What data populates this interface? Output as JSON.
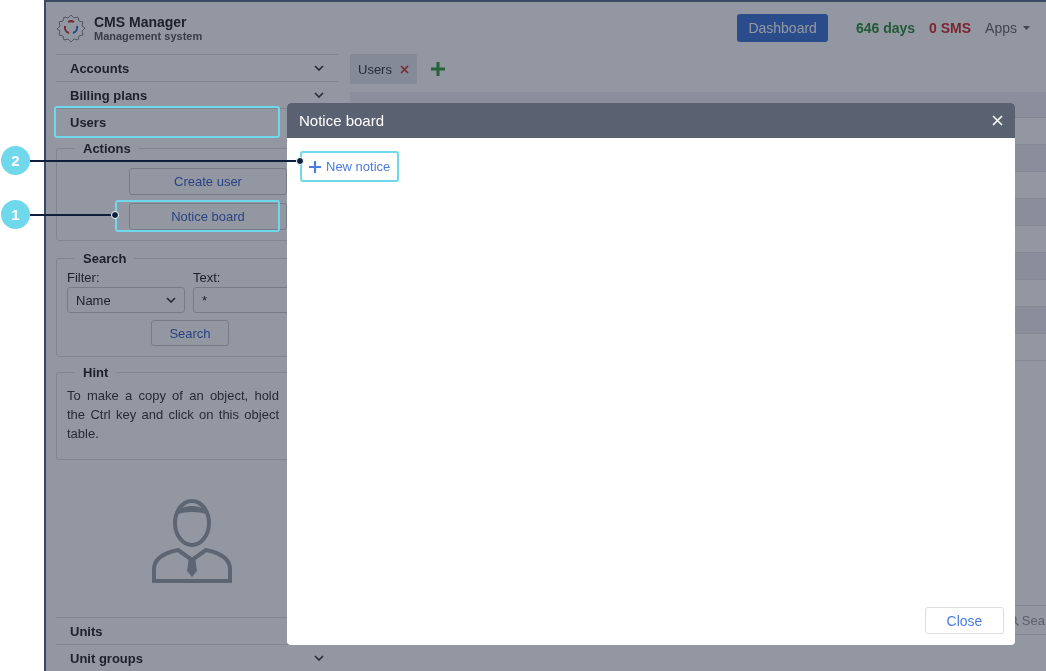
{
  "callouts": [
    {
      "number": "2"
    },
    {
      "number": "1"
    }
  ],
  "app": {
    "title": "CMS Manager",
    "subtitle": "Management system"
  },
  "header": {
    "dashboard": "Dashboard",
    "days": "646 days",
    "sms": "0 SMS",
    "apps": "Apps"
  },
  "sidebar": {
    "items": [
      {
        "label": "Accounts",
        "chevron": true
      },
      {
        "label": "Billing plans",
        "chevron": true
      },
      {
        "label": "Users"
      }
    ],
    "actions": {
      "legend": "Actions",
      "buttons": [
        "Create user",
        "Notice board"
      ]
    },
    "search": {
      "legend": "Search",
      "filter_label": "Filter:",
      "filter_value": "Name",
      "text_label": "Text:",
      "text_value": "*",
      "button": "Search"
    },
    "hint": {
      "legend": "Hint",
      "text": "To make a copy of an object, hold the Ctrl key and click on this object table."
    },
    "bottom_items": [
      {
        "label": "Units"
      },
      {
        "label": "Unit groups",
        "chevron": true
      }
    ]
  },
  "tabs": [
    {
      "label": "Users",
      "selected": true
    }
  ],
  "bottom_search": {
    "placeholder": "Sea"
  },
  "modal": {
    "title": "Notice board",
    "new_button": "New notice",
    "close_button": "Close"
  }
}
